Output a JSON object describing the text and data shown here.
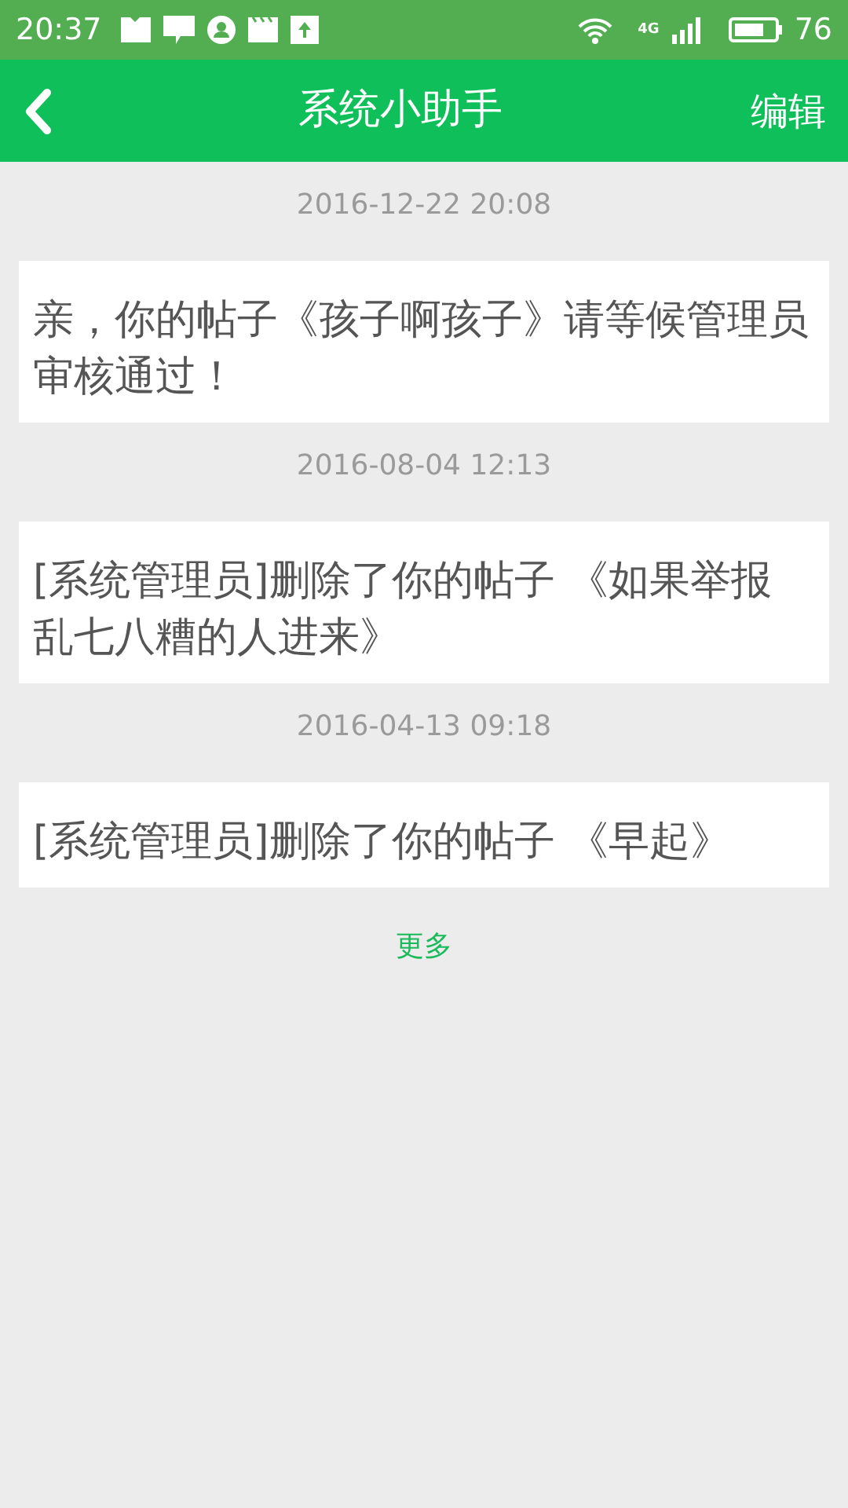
{
  "status_bar": {
    "time": "20:37",
    "network": "4G",
    "battery": "76"
  },
  "nav": {
    "title": "系统小助手",
    "action": "编辑"
  },
  "messages": [
    {
      "time": "2016-12-22 20:08",
      "text": "亲，你的帖子《孩子啊孩子》请等候管理员审核通过！"
    },
    {
      "time": "2016-08-04 12:13",
      "text": "[系统管理员]删除了你的帖子 《如果举报乱七八糟的人进来》"
    },
    {
      "time": "2016-04-13 09:18",
      "text": "[系统管理员]删除了你的帖子 《早起》"
    }
  ],
  "more": "更多"
}
